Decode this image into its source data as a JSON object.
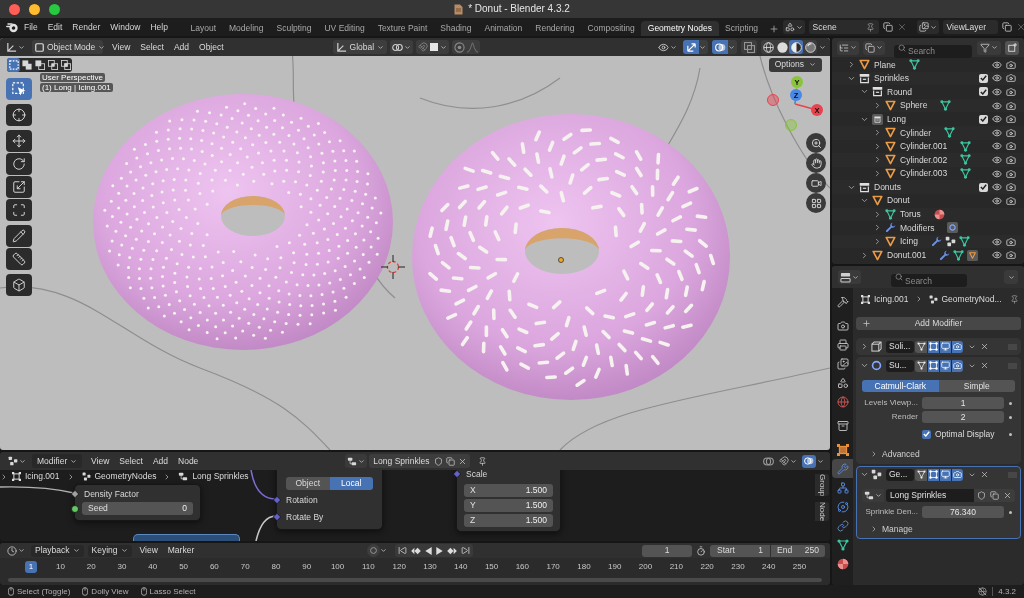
{
  "window": {
    "title": "* Donut - Blender 4.3.2"
  },
  "top_bar": {
    "menus": [
      "File",
      "Edit",
      "Render",
      "Window",
      "Help"
    ],
    "workspaces": [
      {
        "label": "Layout",
        "selected": false
      },
      {
        "label": "Modeling",
        "selected": false
      },
      {
        "label": "Sculpting",
        "selected": false
      },
      {
        "label": "UV Editing",
        "selected": false
      },
      {
        "label": "Texture Paint",
        "selected": false
      },
      {
        "label": "Shading",
        "selected": false
      },
      {
        "label": "Animation",
        "selected": false
      },
      {
        "label": "Rendering",
        "selected": false
      },
      {
        "label": "Compositing",
        "selected": false
      },
      {
        "label": "Geometry Nodes",
        "selected": true
      },
      {
        "label": "Scripting",
        "selected": false
      }
    ],
    "scene": "Scene",
    "view_layer": "ViewLayer"
  },
  "viewport": {
    "mode": "Object Mode",
    "menus": [
      "View",
      "Select",
      "Add",
      "Object"
    ],
    "orientation": "Global",
    "snapping": false,
    "proportional_editing": false,
    "overlays": {
      "gizmos": true,
      "overlays": true,
      "xray": false
    },
    "shading": [
      {
        "kind": "wireframe",
        "selected": false
      },
      {
        "kind": "solid",
        "selected": false
      },
      {
        "kind": "material",
        "selected": true
      },
      {
        "kind": "rendered",
        "selected": false
      }
    ],
    "select_modes": [
      {
        "kind": "set",
        "selected": true
      },
      {
        "kind": "extend",
        "selected": false
      },
      {
        "kind": "subtract",
        "selected": false
      },
      {
        "kind": "invert",
        "selected": false
      },
      {
        "kind": "intersect",
        "selected": false
      }
    ],
    "options": "Options",
    "info": [
      "User Perspective",
      "(1) Long | Icing.001"
    ],
    "tool_groups": [
      {
        "tools": [
          {
            "kind": "select",
            "selected": true
          }
        ]
      },
      {
        "tools": [
          {
            "kind": "cursor",
            "selected": false
          }
        ]
      },
      {
        "tools": [
          {
            "kind": "move",
            "selected": false
          },
          {
            "kind": "rotate",
            "selected": false
          },
          {
            "kind": "scale",
            "selected": false
          },
          {
            "kind": "transform",
            "selected": false
          }
        ]
      },
      {
        "tools": [
          {
            "kind": "annotate",
            "selected": false
          },
          {
            "kind": "measure",
            "selected": false
          }
        ]
      },
      {
        "tools": [
          {
            "kind": "add_cube",
            "selected": false
          }
        ]
      }
    ],
    "axes": [
      {
        "label": "X",
        "color": "#e8434f"
      },
      {
        "label": "Y",
        "color": "#8bc43c"
      },
      {
        "label": "Z",
        "color": "#4a88e8"
      }
    ]
  },
  "outliner": {
    "search": {
      "placeholder": "Search"
    },
    "items": [
      {
        "name": "Plane",
        "kind": "object",
        "expanded": false,
        "active": false,
        "visible": true,
        "data": [
          {
            "kind": "mesh",
            "active": false
          }
        ]
      },
      {
        "name": "Sprinkles",
        "kind": "collection",
        "expanded": true,
        "active": false,
        "checked": true,
        "visible": true,
        "children": [
          {
            "name": "Round",
            "kind": "collection",
            "expanded": true,
            "active": false,
            "checked": true,
            "visible": true,
            "children": [
              {
                "name": "Sphere",
                "kind": "object",
                "expanded": false,
                "active": false,
                "visible": true,
                "data": [
                  {
                    "kind": "mesh",
                    "active": false
                  }
                ]
              }
            ]
          },
          {
            "name": "Long",
            "kind": "collection",
            "expanded": true,
            "active": true,
            "checked": true,
            "visible": true,
            "children": [
              {
                "name": "Cylinder",
                "kind": "object",
                "expanded": false,
                "active": false,
                "visible": true,
                "data": [
                  {
                    "kind": "mesh",
                    "active": false
                  }
                ]
              },
              {
                "name": "Cylinder.001",
                "kind": "object",
                "expanded": false,
                "active": false,
                "visible": true,
                "data": [
                  {
                    "kind": "mesh",
                    "active": false
                  }
                ]
              },
              {
                "name": "Cylinder.002",
                "kind": "object",
                "expanded": false,
                "active": false,
                "visible": true,
                "data": [
                  {
                    "kind": "mesh",
                    "active": false
                  }
                ]
              },
              {
                "name": "Cylinder.003",
                "kind": "object",
                "expanded": false,
                "active": false,
                "visible": true,
                "data": [
                  {
                    "kind": "mesh",
                    "active": false
                  }
                ]
              }
            ]
          }
        ]
      },
      {
        "name": "Donuts",
        "kind": "collection",
        "expanded": true,
        "active": false,
        "checked": true,
        "visible": true,
        "children": [
          {
            "name": "Donut",
            "kind": "object",
            "expanded": true,
            "active": false,
            "visible": true,
            "children": [
              {
                "name": "Torus",
                "kind": "mesh",
                "expanded": false,
                "active": false,
                "data": [
                  {
                    "kind": "material",
                    "active": false
                  }
                ]
              },
              {
                "name": "Modifiers",
                "kind": "modifiers",
                "expanded": false,
                "active": false,
                "data": [
                  {
                    "kind": "subdivision",
                    "active": true
                  }
                ]
              },
              {
                "name": "Icing",
                "kind": "object",
                "expanded": false,
                "active": false,
                "visible": true,
                "data": [
                  {
                    "kind": "modifiers",
                    "active": false
                  },
                  {
                    "kind": "nodes",
                    "active": false
                  },
                  {
                    "kind": "mesh",
                    "active": false
                  }
                ]
              }
            ]
          },
          {
            "name": "Donut.001",
            "kind": "object",
            "expanded": false,
            "active": false,
            "visible": true,
            "data": [
              {
                "kind": "modifiers",
                "active": false
              },
              {
                "kind": "mesh",
                "active": false
              },
              {
                "kind": "object",
                "active": true
              }
            ]
          }
        ]
      }
    ]
  },
  "node_editor": {
    "context": "Modifier",
    "menus": [
      "View",
      "Select",
      "Add",
      "Node"
    ],
    "node_group": "Long Sprinkles",
    "breadcrumbs": [
      "Icing.001",
      "GeometryNodes",
      "Long Sprinkles"
    ],
    "nodes": [
      {
        "kind": "inputs",
        "rows": [
          {
            "kind": "socket",
            "label": "Density Factor",
            "socket": {
              "kind": "diamond",
              "color": "#a1a1a1"
            }
          },
          {
            "kind": "field",
            "label": "Seed",
            "value": "0",
            "socket": {
              "kind": "circle",
              "color": "#63c763"
            }
          }
        ]
      },
      {
        "kind": "rotation",
        "options": [
          {
            "label": "Object",
            "selected": false
          },
          {
            "label": "Local",
            "selected": true
          }
        ],
        "rows": [
          {
            "kind": "socket",
            "label": "Rotation",
            "socket": {
              "kind": "diamond",
              "color": "#6363c7"
            }
          },
          {
            "kind": "socket",
            "label": "Rotate By",
            "socket": {
              "kind": "diamond",
              "color": "#6363c7"
            }
          }
        ]
      },
      {
        "kind": "scale",
        "rows": [
          {
            "kind": "socket",
            "label": "Scale",
            "socket": {
              "kind": "diamond",
              "color": "#6363c7"
            }
          },
          {
            "kind": "field",
            "label": "X",
            "value": "1.500"
          },
          {
            "kind": "field",
            "label": "Y",
            "value": "1.500"
          },
          {
            "kind": "field",
            "label": "Z",
            "value": "1.500"
          }
        ]
      }
    ],
    "sidebar_tabs": [
      "Group",
      "Node"
    ]
  },
  "properties": {
    "search": {
      "placeholder": "Search"
    },
    "tab_groups": [
      {
        "tabs": [
          {
            "kind": "tool",
            "selected": false
          }
        ]
      },
      {
        "tabs": [
          {
            "kind": "render",
            "selected": false
          },
          {
            "kind": "output",
            "selected": false
          },
          {
            "kind": "view_layer",
            "selected": false
          },
          {
            "kind": "scene",
            "selected": false
          },
          {
            "kind": "world",
            "selected": false
          }
        ]
      },
      {
        "tabs": [
          {
            "kind": "collection",
            "selected": false
          }
        ]
      },
      {
        "tabs": [
          {
            "kind": "object",
            "selected": false
          },
          {
            "kind": "modifiers",
            "selected": true
          },
          {
            "kind": "particles",
            "selected": false
          },
          {
            "kind": "physics",
            "selected": false
          },
          {
            "kind": "constraints",
            "selected": false
          },
          {
            "kind": "data",
            "selected": false
          },
          {
            "kind": "material",
            "selected": false
          }
        ]
      }
    ],
    "breadcrumb": [
      "Icing.001",
      "GeometryNod..."
    ],
    "add_modifier": "Add Modifier",
    "modifiers": [
      {
        "name": "Soli...",
        "kind": "solidify",
        "expanded": false,
        "active": false,
        "toggles": [
          {
            "kind": "cage",
            "on": false
          },
          {
            "kind": "edit",
            "on": true
          },
          {
            "kind": "viewport",
            "on": true
          },
          {
            "kind": "render",
            "on": true
          }
        ]
      },
      {
        "name": "Su...",
        "kind": "subdivision",
        "expanded": true,
        "active": false,
        "toggles": [
          {
            "kind": "cage",
            "on": false
          },
          {
            "kind": "edit",
            "on": true
          },
          {
            "kind": "viewport",
            "on": true
          },
          {
            "kind": "render",
            "on": true
          }
        ],
        "methods": [
          {
            "label": "Catmull-Clark",
            "selected": true
          },
          {
            "label": "Simple",
            "selected": false
          }
        ],
        "fields": [
          {
            "label": "Levels Viewp...",
            "value": "1"
          },
          {
            "label": "Render",
            "value": "2"
          }
        ],
        "checkbox": {
          "label": "Optimal Display",
          "checked": true
        },
        "subpanels": [
          {
            "label": "Advanced",
            "expanded": false
          }
        ]
      },
      {
        "name": "Ge...",
        "kind": "nodes",
        "expanded": true,
        "active": true,
        "toggles": [
          {
            "kind": "cage",
            "on": false
          },
          {
            "kind": "edit",
            "on": true
          },
          {
            "kind": "viewport",
            "on": true
          },
          {
            "kind": "render",
            "on": true
          }
        ],
        "node_group": "Long Sprinkles",
        "fields": [
          {
            "label": "Sprinkle Den...",
            "value": "76.340"
          }
        ],
        "subpanels": [
          {
            "label": "Manage",
            "expanded": false
          }
        ]
      }
    ]
  },
  "timeline": {
    "menus": [
      "Playback",
      "Keying"
    ],
    "view_menus": [
      "View",
      "Marker"
    ],
    "current_frame": "1",
    "start": {
      "label": "Start",
      "value": "1"
    },
    "end": {
      "label": "End",
      "value": "250"
    },
    "frames": [
      {
        "label": "1",
        "selected": true
      },
      {
        "label": "10",
        "selected": false
      },
      {
        "label": "20",
        "selected": false
      },
      {
        "label": "30",
        "selected": false
      },
      {
        "label": "40",
        "selected": false
      },
      {
        "label": "50",
        "selected": false
      },
      {
        "label": "60",
        "selected": false
      },
      {
        "label": "70",
        "selected": false
      },
      {
        "label": "80",
        "selected": false
      },
      {
        "label": "90",
        "selected": false
      },
      {
        "label": "100",
        "selected": false
      },
      {
        "label": "110",
        "selected": false
      },
      {
        "label": "120",
        "selected": false
      },
      {
        "label": "130",
        "selected": false
      },
      {
        "label": "140",
        "selected": false
      },
      {
        "label": "150",
        "selected": false
      },
      {
        "label": "160",
        "selected": false
      },
      {
        "label": "170",
        "selected": false
      },
      {
        "label": "180",
        "selected": false
      },
      {
        "label": "190",
        "selected": false
      },
      {
        "label": "200",
        "selected": false
      },
      {
        "label": "210",
        "selected": false
      },
      {
        "label": "220",
        "selected": false
      },
      {
        "label": "230",
        "selected": false
      },
      {
        "label": "240",
        "selected": false
      },
      {
        "label": "250",
        "selected": false
      }
    ]
  },
  "status_bar": {
    "hints": [
      "Select (Toggle)",
      "Dolly View",
      "Lasso Select"
    ],
    "version": "4.3.2"
  }
}
